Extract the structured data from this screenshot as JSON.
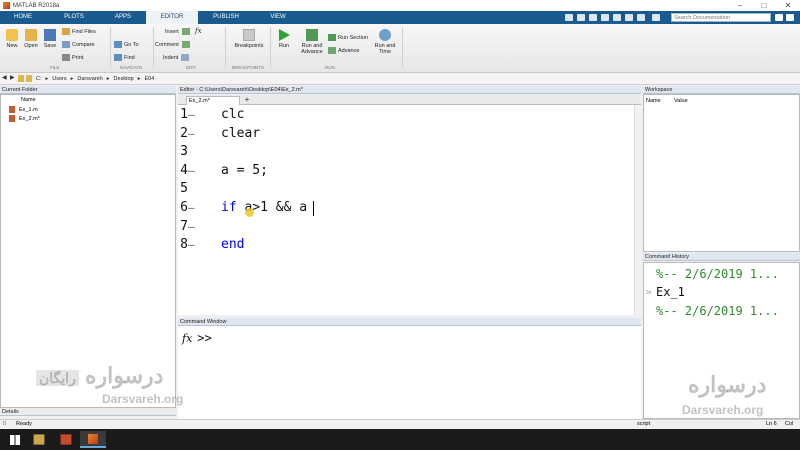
{
  "window": {
    "title": "MATLAB R2018a"
  },
  "ribbon": {
    "tabs": [
      {
        "label": "HOME",
        "active": false
      },
      {
        "label": "PLOTS",
        "active": false
      },
      {
        "label": "APPS",
        "active": false
      },
      {
        "label": "EDITOR",
        "active": true
      },
      {
        "label": "PUBLISH",
        "active": false
      },
      {
        "label": "VIEW",
        "active": false
      }
    ],
    "search_placeholder": "Search Documentation",
    "file": {
      "new": "New",
      "open": "Open",
      "save": "Save",
      "find_files": "Find Files",
      "compare": "Compare",
      "print": "Print",
      "group": "FILE"
    },
    "navigate": {
      "go_to": "Go To",
      "find": "Find",
      "group": "NAVIGATE"
    },
    "edit": {
      "insert": "Insert",
      "comment": "Comment",
      "indent": "Indent",
      "fx": "fx",
      "group": "EDIT"
    },
    "breakpoints": {
      "label": "Breakpoints",
      "group": "BREAKPOINTS"
    },
    "run": {
      "run": "Run",
      "run_and_advance_1": "Run and",
      "run_and_advance_2": "Advance",
      "run_section": "Run Section",
      "advance": "Advance",
      "run_and_time_1": "Run and",
      "run_and_time_2": "Time",
      "group": "RUN"
    }
  },
  "address": {
    "drive": "C:",
    "crumbs": [
      "Users",
      "Darsvareh",
      "Desktop",
      "E04"
    ]
  },
  "current_folder": {
    "title": "Current Folder",
    "column": "Name",
    "files": [
      "Ex_1.m",
      "Ex_2.m*"
    ],
    "details": "Details"
  },
  "editor": {
    "title": "Editor - C:\\Users\\Darsvareh\\Desktop\\E04\\Ex_2.m*",
    "tab": "Ex_2.m*",
    "plus": "+",
    "lines": [
      {
        "n": "1",
        "code": "clc"
      },
      {
        "n": "2",
        "code": "clear"
      },
      {
        "n": "3",
        "code": ""
      },
      {
        "n": "4",
        "code": "a = 5;"
      },
      {
        "n": "5",
        "code": ""
      },
      {
        "n": "6",
        "code": "a>1 && a",
        "keyword": "if"
      },
      {
        "n": "7",
        "code": ""
      },
      {
        "n": "8",
        "code": "end",
        "keyword_line": true
      }
    ]
  },
  "command_window": {
    "title": "Command Window",
    "prompt": ">>",
    "fx": "fx"
  },
  "workspace": {
    "title": "Workspace",
    "col_name": "Name",
    "col_value": "Value"
  },
  "history": {
    "title": "Command History",
    "entries": [
      "%-- 2/6/2019 1...",
      "Ex_1",
      "%-- 2/6/2019 1..."
    ]
  },
  "status": {
    "ready": "Ready",
    "mode": "script",
    "position": "Ln 6",
    "col": "Col"
  },
  "watermark": {
    "brand_fa": "درسواره",
    "tag_fa": "رایگان",
    "site": "Darsvareh.org"
  }
}
